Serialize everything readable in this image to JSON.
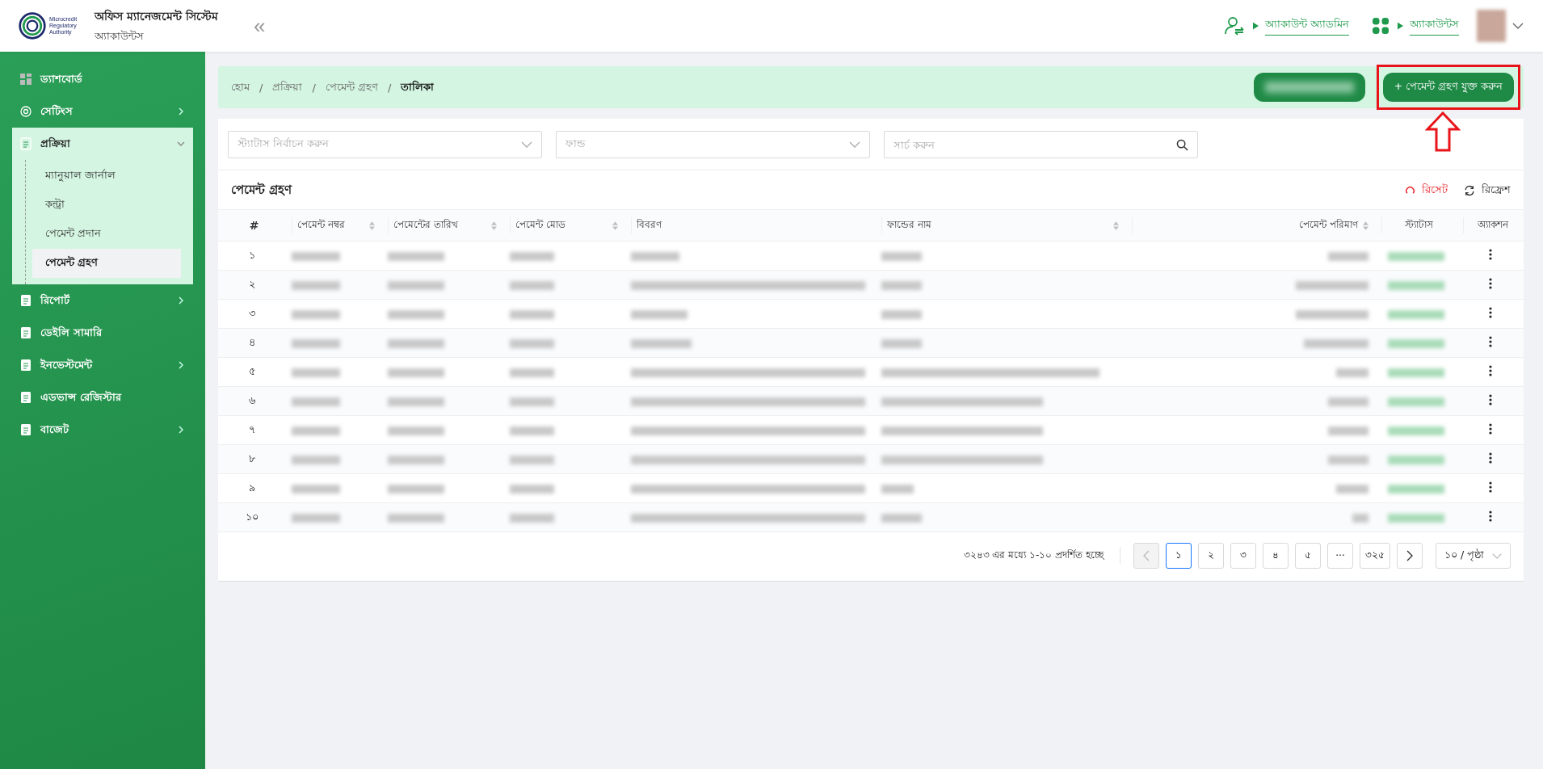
{
  "header": {
    "logo_text": [
      "Microcredit",
      "Regulatory",
      "Authority"
    ],
    "title": "অফিস ম্যানেজমেন্ট সিস্টেম",
    "subtitle": "অ্যাকাউন্টস",
    "collapse": "«",
    "links": [
      {
        "label": "অ্যাকাউন্ট অ্যাডমিন"
      },
      {
        "label": "অ্যাকাউন্টস"
      }
    ]
  },
  "sidebar": {
    "items": [
      {
        "label": "ড্যাশবোর্ড"
      },
      {
        "label": "সেটিংস",
        "expanded": false
      },
      {
        "label": "প্রক্রিয়া",
        "expanded": true,
        "children": [
          {
            "label": "ম্যানুয়াল জার্নাল",
            "selected": false
          },
          {
            "label": "কন্ট্রা",
            "selected": false
          },
          {
            "label": "পেমেন্ট প্রদান",
            "selected": false
          },
          {
            "label": "পেমেন্ট গ্রহণ",
            "selected": true
          }
        ]
      },
      {
        "label": "রিপোর্ট",
        "expanded": false
      },
      {
        "label": "ডেইলি সামারি"
      },
      {
        "label": "ইনভেস্টমেন্ট",
        "expanded": false
      },
      {
        "label": "এডভান্স রেজিস্টার"
      },
      {
        "label": "বাজেট",
        "expanded": false
      }
    ]
  },
  "breadcrumb": [
    "হোম",
    "প্রক্রিয়া",
    "পেমেন্ট গ্রহণ",
    "তালিকা"
  ],
  "breadcrumb_separator": "/",
  "add_button": "+ পেমেন্ট গ্রহণ যুক্ত করুন",
  "filters": {
    "status": {
      "placeholder": "স্ট্যাটাস নির্বাচন করুন"
    },
    "fund": {
      "placeholder": "ফান্ড"
    },
    "search": {
      "placeholder": "সার্চ করুন"
    }
  },
  "table": {
    "title": "পেমেন্ট গ্রহণ",
    "reset": "রিসেট",
    "refresh": "রিফ্রেশ",
    "columns": [
      {
        "label": "#",
        "sortable": false
      },
      {
        "label": "পেমেন্ট নম্বর",
        "sortable": true
      },
      {
        "label": "পেমেন্টের তারিখ",
        "sortable": true
      },
      {
        "label": "পেমেন্ট মোড",
        "sortable": true
      },
      {
        "label": "বিবরণ",
        "sortable": false
      },
      {
        "label": "ফান্ডের নাম",
        "sortable": true
      },
      {
        "label": "পেমেন্ট পরিমাণ",
        "sortable": true
      },
      {
        "label": "স্ট্যাটাস",
        "sortable": false
      },
      {
        "label": "অ্যাকশন",
        "sortable": false
      }
    ],
    "rows": [
      {
        "number": "১"
      },
      {
        "number": "২"
      },
      {
        "number": "৩"
      },
      {
        "number": "৪"
      },
      {
        "number": "৫"
      },
      {
        "number": "৬"
      },
      {
        "number": "৭"
      },
      {
        "number": "৮"
      },
      {
        "number": "৯"
      },
      {
        "number": "১০"
      }
    ]
  },
  "pagination": {
    "info": "৩২৪৩ এর মধ্যে ১-১০ প্রদর্শিত হচ্ছে",
    "prev_disabled": true,
    "pages": [
      {
        "label": "১",
        "selected": true
      },
      {
        "label": "২",
        "selected": false
      },
      {
        "label": "৩",
        "selected": false
      },
      {
        "label": "৪",
        "selected": false
      },
      {
        "label": "৫",
        "selected": false
      },
      {
        "label": "···",
        "selected": false
      },
      {
        "label": "৩২৫",
        "selected": false
      }
    ],
    "page_size": "১০ / পৃষ্ঠা"
  }
}
